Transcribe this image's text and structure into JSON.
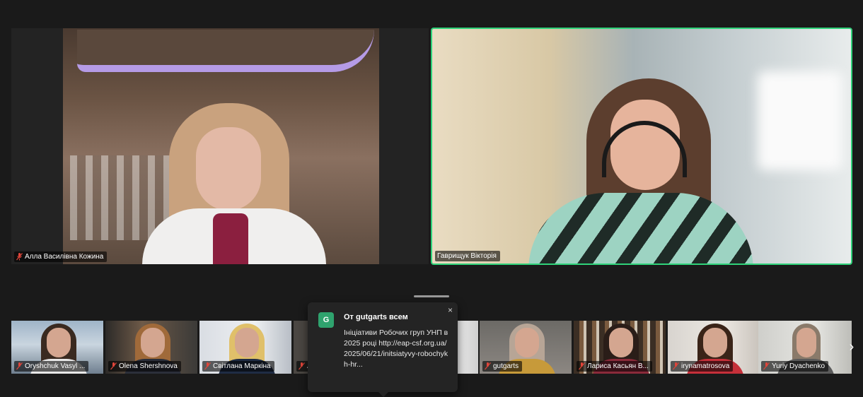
{
  "main_tiles": [
    {
      "name": "Алла Василівна Кожина",
      "muted": true,
      "active_speaker": false
    },
    {
      "name": "Гаврищук Вікторія",
      "muted": false,
      "active_speaker": true
    }
  ],
  "thumbnails": [
    {
      "name": "Oryshchuk Vasyl ...",
      "muted": true
    },
    {
      "name": "Olena Shershnova",
      "muted": true
    },
    {
      "name": "Світлана  Маркіна",
      "muted": true
    },
    {
      "name": "A",
      "muted": true
    },
    {
      "name": "",
      "muted": false
    },
    {
      "name": "gutgarts",
      "muted": true
    },
    {
      "name": "Лариса Касьян В...",
      "muted": true
    },
    {
      "name": "irynamatrosova",
      "muted": true
    },
    {
      "name": "Yuriy Dyachenko",
      "muted": true
    }
  ],
  "chat_popup": {
    "avatar_letter": "G",
    "from": "От gutgarts всем",
    "message": "Ініціативи Робочих груп УНП в 2025 році http://eap-csf.org.ua/2025/06/21/initsiatyvy-robochykh-hr...",
    "close_icon": "×"
  },
  "strip": {
    "next_icon": "›"
  },
  "colors": {
    "active_speaker_border": "#2fd37a",
    "mic_off": "#e0453a",
    "avatar_bg": "#2fa36e"
  }
}
